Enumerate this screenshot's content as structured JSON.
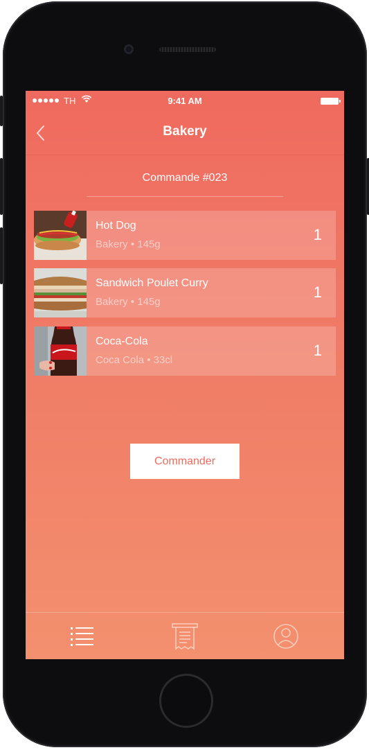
{
  "status_bar": {
    "carrier": "TH",
    "time": "9:41 AM"
  },
  "nav": {
    "title": "Bakery",
    "back_icon": "chevron-left-icon"
  },
  "order": {
    "title": "Commande #023"
  },
  "items": [
    {
      "name": "Hot Dog",
      "meta": "Bakery • 145g",
      "qty": "1",
      "thumb": "hot-dog-image"
    },
    {
      "name": "Sandwich Poulet Curry",
      "meta": "Bakery • 145g",
      "qty": "1",
      "thumb": "sandwich-image"
    },
    {
      "name": "Coca-Cola",
      "meta": "Coca Cola • 33cl",
      "qty": "1",
      "thumb": "coca-cola-image"
    }
  ],
  "order_button": {
    "label": "Commander"
  },
  "tabs": [
    {
      "icon": "list-icon"
    },
    {
      "icon": "receipt-icon"
    },
    {
      "icon": "user-icon"
    }
  ],
  "colors": {
    "gradient_top": "#ef6a5e",
    "gradient_bottom": "#f3906e",
    "button_text": "#ee6a5d"
  }
}
